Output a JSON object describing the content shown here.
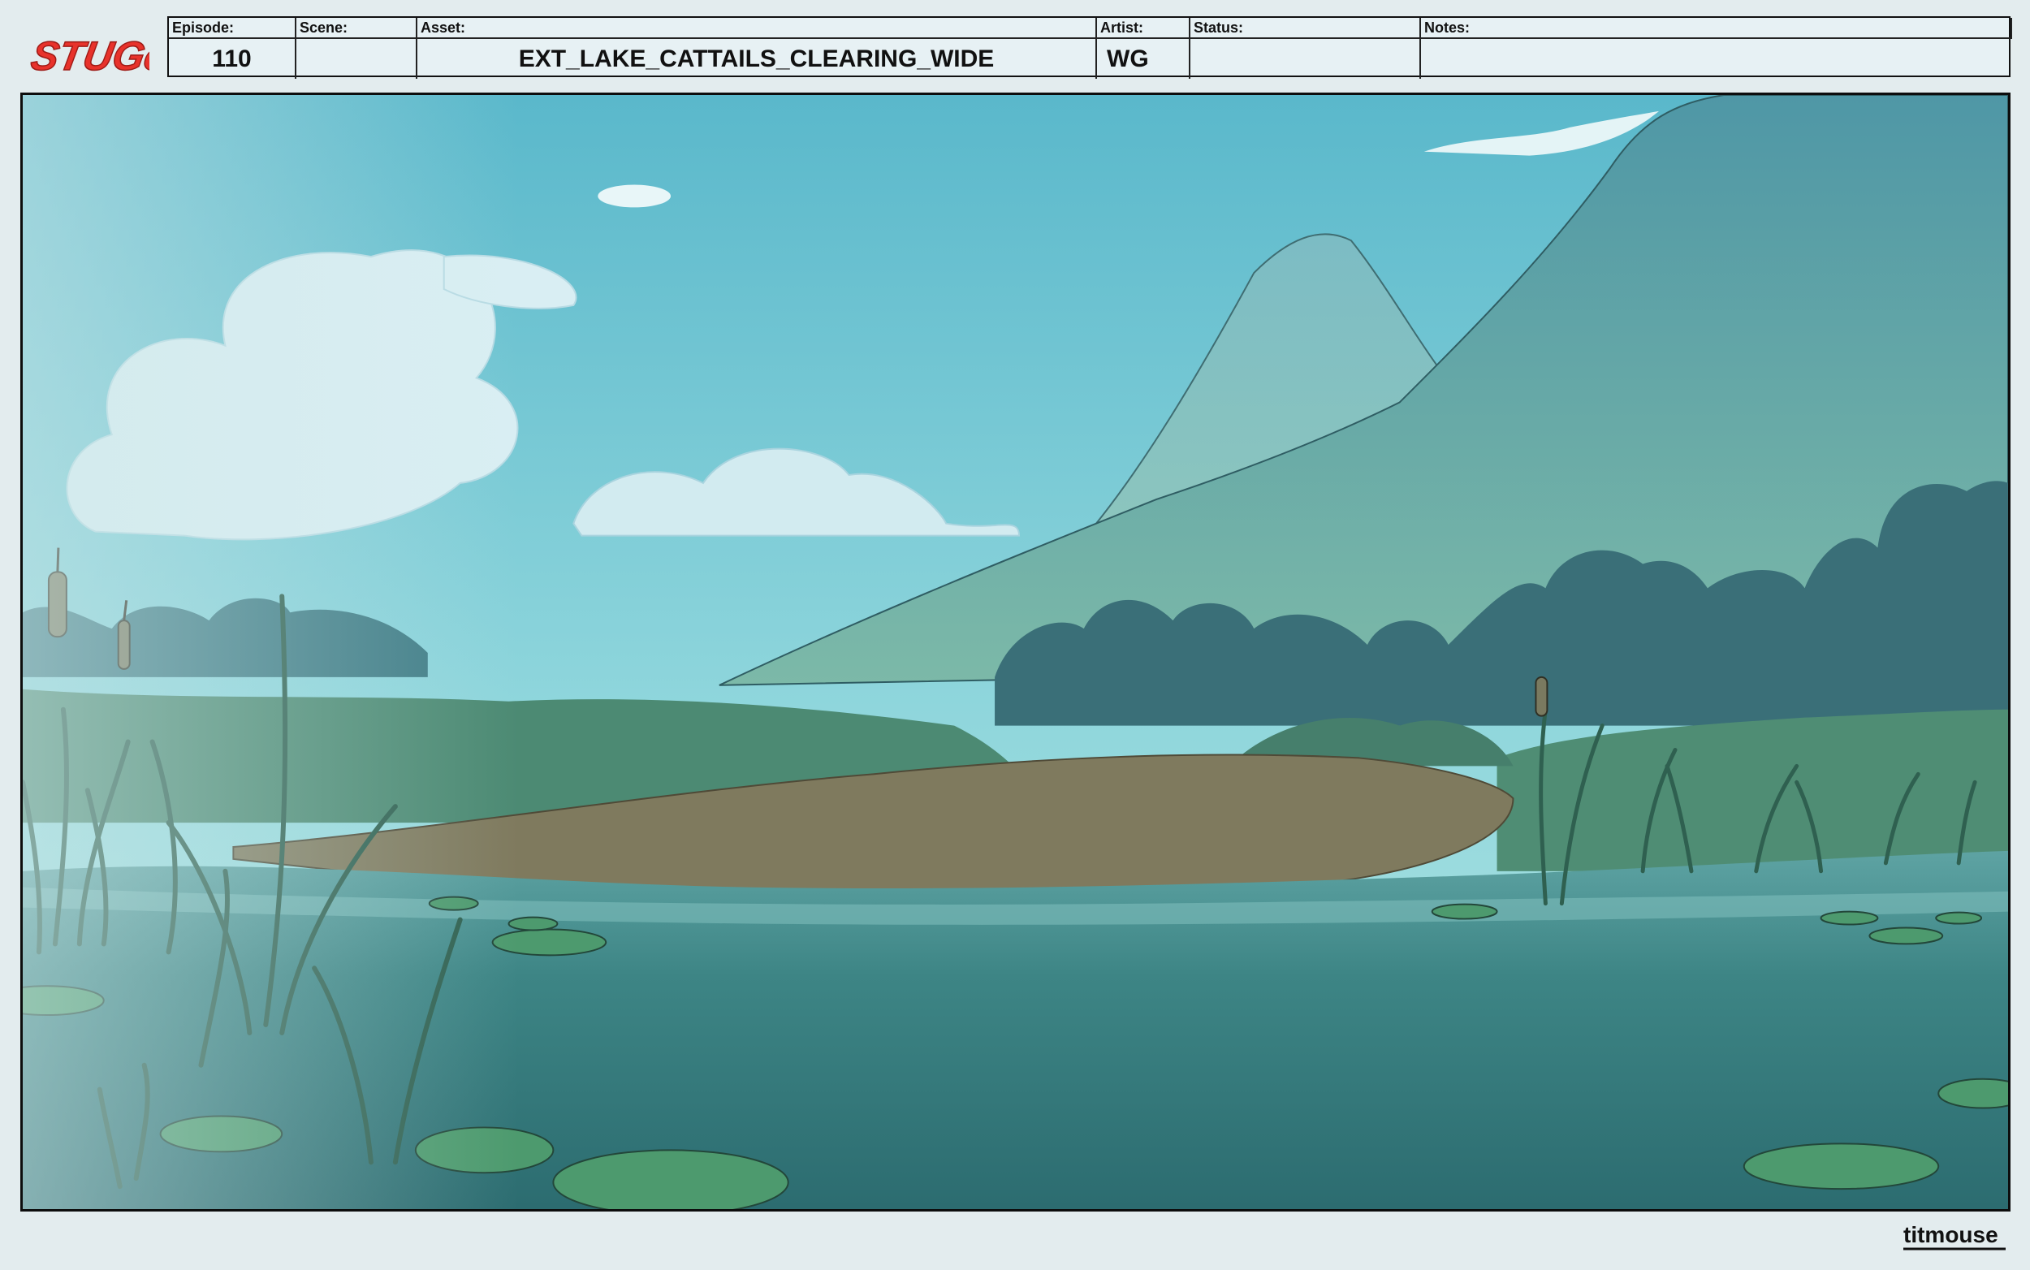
{
  "brand": {
    "show_logo": "STUGo",
    "studio_logo": "titmouse"
  },
  "slate": {
    "episode_label": "Episode:",
    "scene_label": "Scene:",
    "asset_label": "Asset:",
    "artist_label": "Artist:",
    "status_label": "Status:",
    "notes_label": "Notes:",
    "episode": "110",
    "scene": "",
    "asset": "EXT_LAKE_CATTAILS_CLEARING_WIDE",
    "artist": "WG",
    "status": "",
    "notes": ""
  },
  "colors": {
    "sky_top": "#5fbcce",
    "sky_bottom": "#a7e2e3",
    "mountain": "#5c9ea3",
    "water": "#3f8788",
    "shore": "#7f7a5e",
    "logo_red": "#e8322b"
  }
}
